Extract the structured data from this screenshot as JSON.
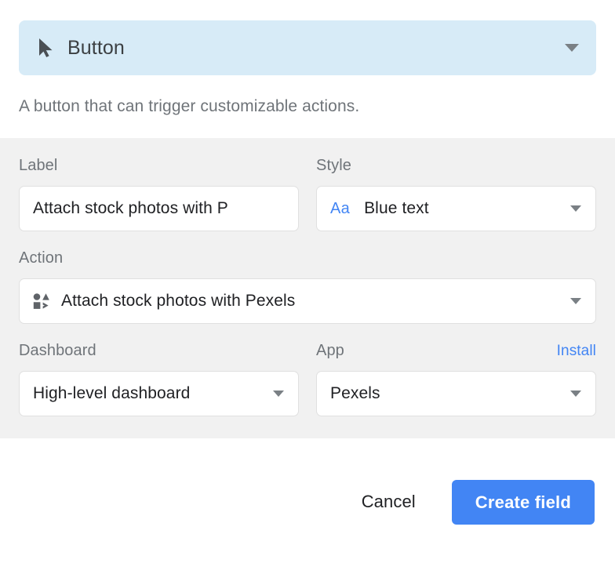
{
  "header": {
    "icon": "cursor-arrow-icon",
    "title": "Button",
    "chevron": "chevron-down-icon",
    "background_color": "#d7ebf7"
  },
  "description": "A button that can trigger customizable actions.",
  "form": {
    "label_field": {
      "label": "Label",
      "value": "Attach stock photos with P",
      "placeholder": "Label"
    },
    "style_field": {
      "label": "Style",
      "icon": "Aa",
      "icon_color": "#4285f4",
      "value": "Blue text",
      "chevron": "chevron-down-icon"
    },
    "action_field": {
      "label": "Action",
      "icon": "shapes-grid-icon",
      "value": "Attach stock photos with Pexels",
      "chevron": "chevron-down-icon"
    },
    "dashboard_field": {
      "label": "Dashboard",
      "value": "High-level dashboard",
      "chevron": "chevron-down-icon"
    },
    "app_field": {
      "label": "App",
      "value": "Pexels",
      "chevron": "chevron-down-icon",
      "install_link": "Install",
      "install_link_color": "#4285f4"
    }
  },
  "footer": {
    "cancel_label": "Cancel",
    "primary_label": "Create field",
    "primary_color": "#4285f4"
  }
}
